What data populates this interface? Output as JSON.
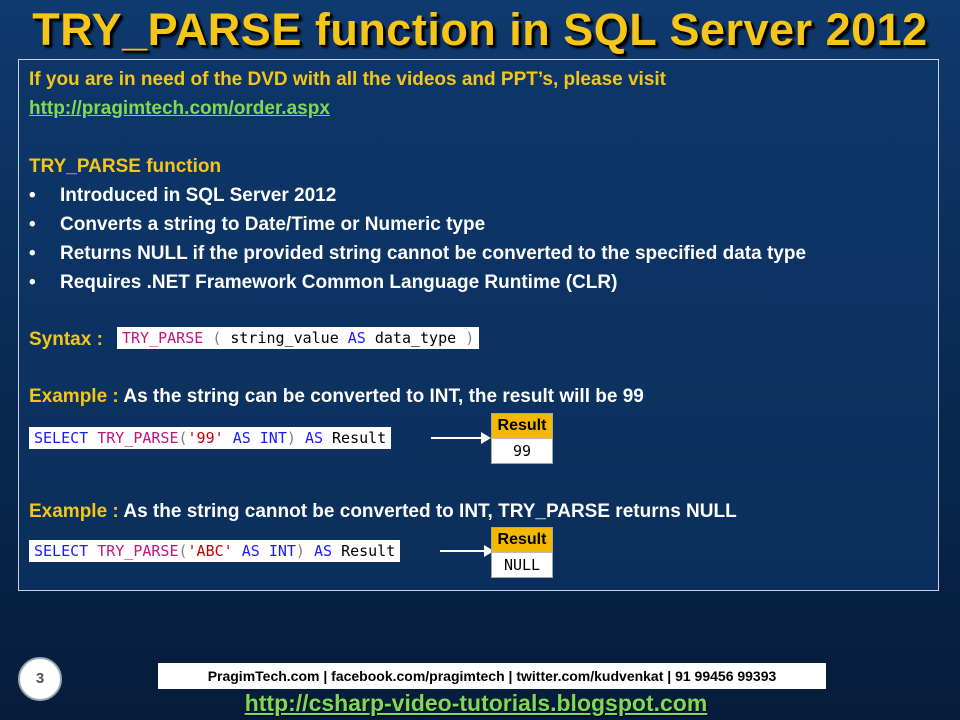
{
  "slide": {
    "title": "TRY_PARSE function in SQL Server 2012",
    "dvd_note": "If you are in need of the DVD with all the videos and PPT’s, please visit",
    "order_link": "http://pragimtech.com/order.aspx",
    "section_heading": "TRY_PARSE function",
    "bullets": [
      "Introduced in SQL Server 2012",
      "Converts a string to Date/Time or Numeric type",
      "Returns NULL if the provided string cannot be converted to the specified data type",
      "Requires .NET Framework Common Language Runtime (CLR)"
    ],
    "syntax": {
      "label": "Syntax :",
      "fn": "TRY_PARSE",
      "open": "(",
      "arg": "string_value",
      "as": "AS",
      "type": "data_type",
      "close": ")"
    },
    "example1": {
      "label": "Example :",
      "text": "As the string can be converted to INT, the result will be 99",
      "code": {
        "select": "SELECT",
        "fn": "TRY_PARSE",
        "open": "(",
        "str": "'99'",
        "as1": "AS",
        "int": "INT",
        "close": ")",
        "as2": "AS",
        "alias": "Result"
      },
      "result_header": "Result",
      "result_value": "99"
    },
    "example2": {
      "label": "Example :",
      "text": "As the string cannot be converted to INT, TRY_PARSE returns NULL",
      "code": {
        "select": "SELECT",
        "fn": "TRY_PARSE",
        "open": "(",
        "str": "'ABC'",
        "as1": "AS",
        "int": "INT",
        "close": ")",
        "as2": "AS",
        "alias": "Result"
      },
      "result_header": "Result",
      "result_value": "NULL"
    },
    "page_number": "3",
    "footer_contacts": "PragimTech.com | facebook.com/pragimtech | twitter.com/kudvenkat | 91 99456 99393",
    "footer_link": "http://csharp-video-tutorials.blogspot.com"
  }
}
